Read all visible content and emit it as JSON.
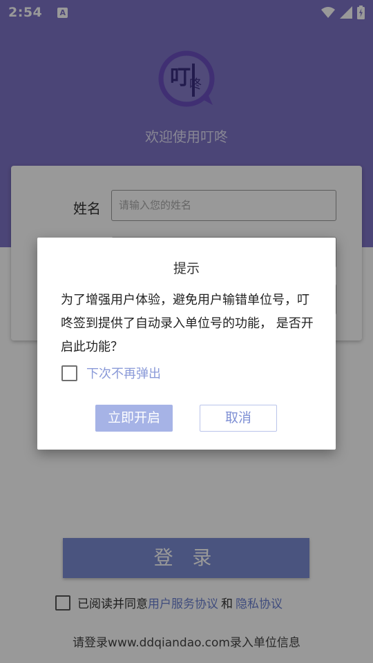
{
  "status_bar": {
    "time": "2:54",
    "notification_icon_letter": "A"
  },
  "app": {
    "welcome_text": "欢迎使用叮咚",
    "logo_icon": "ding-dong-speech-bubble-icon",
    "logo_text": "叮咚"
  },
  "form": {
    "name_label": "姓名",
    "name_placeholder": "请输入您的姓名"
  },
  "login": {
    "button_label": "登 录",
    "agree_prefix": "已阅读并同意",
    "user_agreement": "用户服务协议",
    "and_text": "和",
    "privacy_policy": "隐私协议",
    "footer": "请登录www.ddqiandao.com录入单位信息"
  },
  "dialog": {
    "title": "提示",
    "message": "为了增强用户体验，避免用户输错单位号，叮咚签到提供了自动录入单位号的功能， 是否开启此功能？",
    "dont_show_again": "下次不再弹出",
    "enable_label": "立即开启",
    "cancel_label": "取消"
  },
  "colors": {
    "primary": "#7e73c6",
    "button": "#7c8dd4",
    "link": "#6a7fd0",
    "dialog_enable": "#a6b3e6"
  }
}
